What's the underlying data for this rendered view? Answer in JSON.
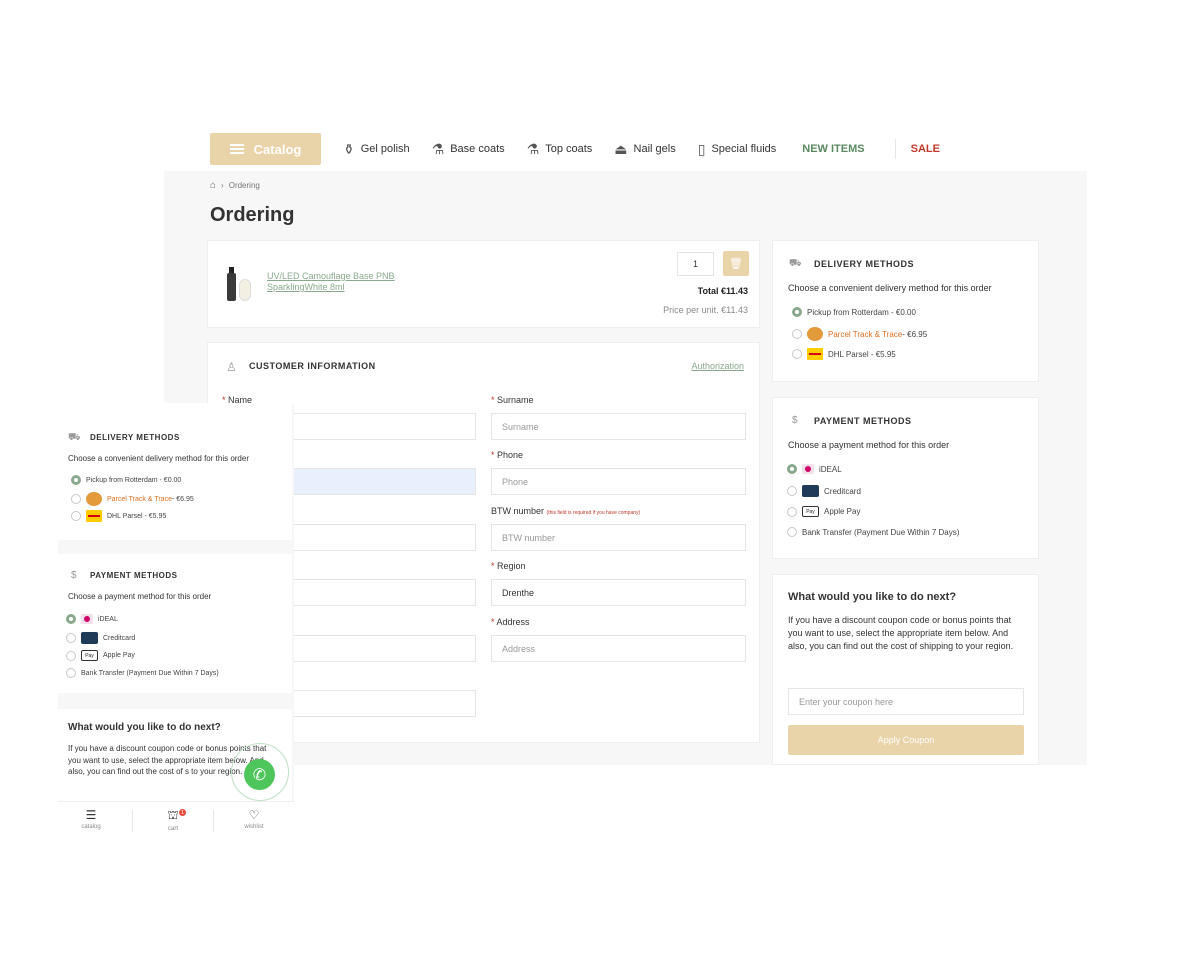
{
  "nav": {
    "catalog_label": "Catalog",
    "items": [
      {
        "label": "Gel polish",
        "icon": "bottle-icon"
      },
      {
        "label": "Base coats",
        "icon": "base-coat-icon"
      },
      {
        "label": "Top coats",
        "icon": "top-coat-icon"
      },
      {
        "label": "Nail gels",
        "icon": "nail-gel-icon"
      },
      {
        "label": "Special fluids",
        "icon": "fluid-icon"
      }
    ],
    "new_items": "NEW ITEMS",
    "sale": "SALE"
  },
  "breadcrumb": {
    "home_icon": "home-icon",
    "separator": "›",
    "current": "Ordering"
  },
  "page_title": "Ordering",
  "product": {
    "name": "UV/LED Camouflage Base PNB SparklingWhite 8ml",
    "quantity": "1",
    "total": "Total €11.43",
    "unit_price": "Price per unit. €11.43"
  },
  "customer": {
    "title": "CUSTOMER INFORMATION",
    "authorization": "Authorization",
    "required_mark": "*",
    "name_label": "Name",
    "surname_label": "Surname",
    "surname_placeholder": "Surname",
    "phone_label": "Phone",
    "phone_placeholder": "Phone",
    "btw_label": "BTW number",
    "btw_hint": "(this field is required if you have company)",
    "btw_placeholder": "BTW number",
    "region_label": "Region",
    "region_value": "Drenthe",
    "address_label": "Address",
    "address_placeholder": "Address"
  },
  "delivery": {
    "title": "DELIVERY METHODS",
    "description": "Choose a convenient delivery method for this order",
    "options": [
      {
        "label": "Pickup from Rotterdam - €0.00"
      },
      {
        "label": "Parcel Track & Trace",
        "price": "- €6.95"
      },
      {
        "label": "DHL Parsel - €5.95"
      }
    ]
  },
  "payment": {
    "title": "PAYMENT METHODS",
    "description": "Choose a payment method for this order",
    "options": [
      {
        "label": "iDEAL"
      },
      {
        "label": "Creditcard"
      },
      {
        "label": "Apple Pay",
        "logo_text": "Pay"
      },
      {
        "label": "Bank Transfer (Payment Due Within 7 Days)"
      }
    ]
  },
  "next": {
    "title": "What would you like to do next?",
    "body": "If you have a discount coupon code or bonus points that you want to use, select the appropriate item below. And also, you can find out the cost of shipping to your region.",
    "mobile_body": "If you have a discount coupon code or bonus points that you want to use, select the appropriate item below. And also, you can find out the cost of s to your region.",
    "coupon_placeholder": "Enter your coupon here",
    "apply_label": "Apply Coupon"
  },
  "mobile_tabs": [
    {
      "label": "catalog"
    },
    {
      "label": "cart",
      "badge": "1"
    },
    {
      "label": "wishlist"
    }
  ],
  "colors": {
    "accent": "#e9d3a8",
    "green": "#8aa98c",
    "sale": "#c0392b",
    "whatsapp": "#4fc65c"
  }
}
